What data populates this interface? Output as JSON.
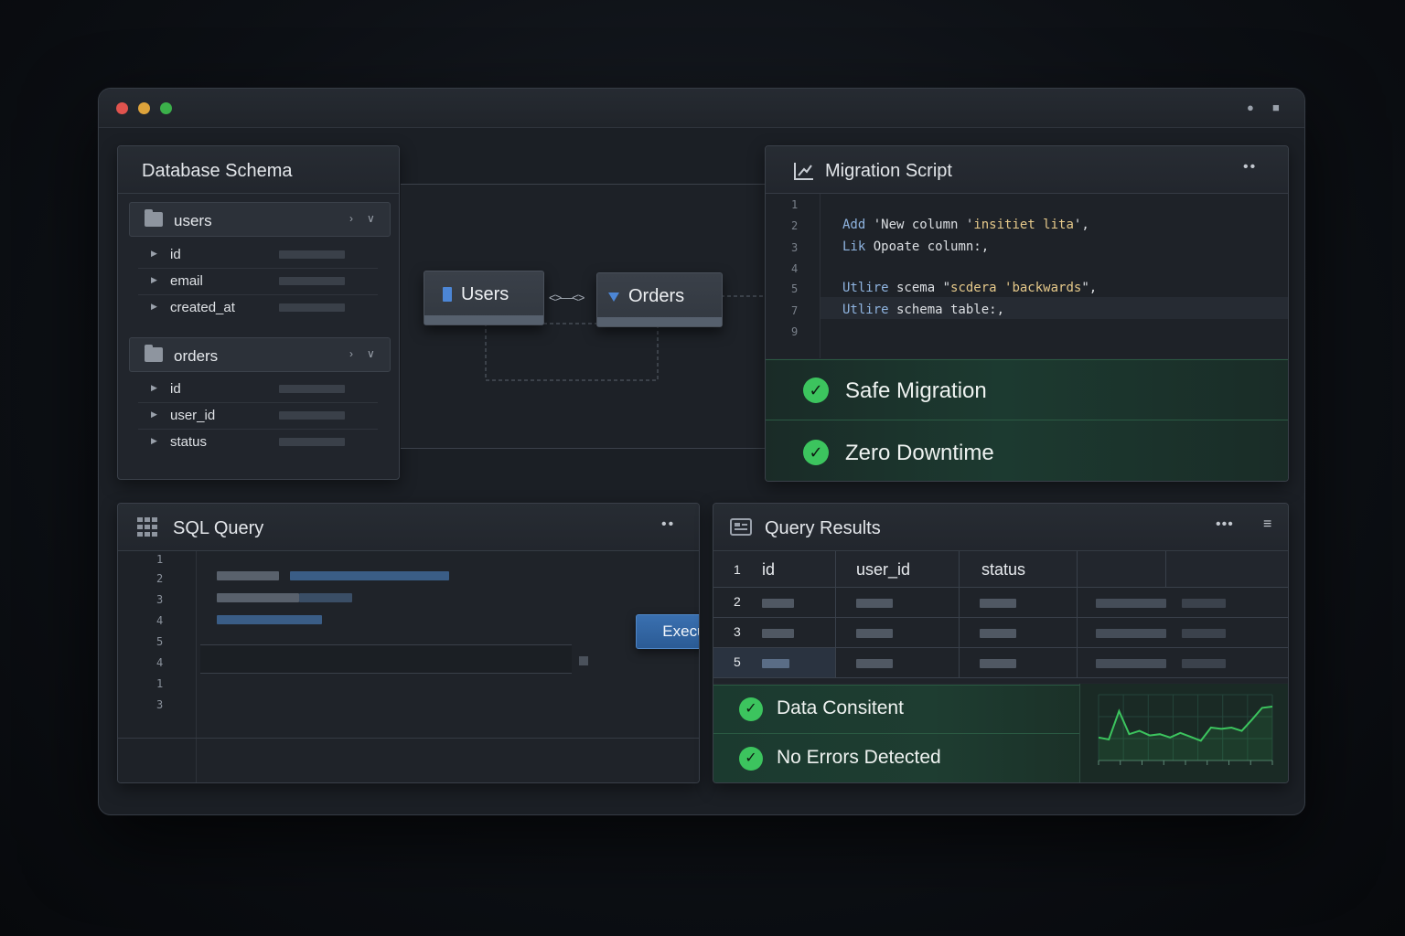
{
  "schema": {
    "title": "Database Schema",
    "tables": [
      {
        "name": "users",
        "columns": [
          "id",
          "email",
          "created_at"
        ]
      },
      {
        "name": "orders",
        "columns": [
          "id",
          "user_id",
          "status"
        ]
      }
    ]
  },
  "diagram": {
    "nodes": [
      "Users",
      "Orders"
    ],
    "connector": "<>"
  },
  "migration": {
    "title": "Migration Script",
    "line_numbers": [
      "1",
      "2",
      "3",
      "4",
      "5",
      "7",
      "9"
    ],
    "lines": [
      {
        "kw": "",
        "text": ""
      },
      {
        "kw": "Add",
        "text": " 'New column '",
        "str": "insitiet lita",
        "tail": "',"
      },
      {
        "kw": "Lik",
        "text": " Opoate column:,"
      },
      {
        "kw": "",
        "text": ""
      },
      {
        "kw": "Utlire",
        "text": " scema \"",
        "str": "scdera 'backwards",
        "tail": "\","
      },
      {
        "kw": "Utlire",
        "text": " schema table:,"
      },
      {
        "kw": "",
        "text": ""
      }
    ],
    "checks": [
      "Safe Migration",
      "Zero Downtime"
    ]
  },
  "sql": {
    "title": "SQL Query",
    "line_numbers": [
      "1",
      "2",
      "3",
      "4",
      "5",
      "4",
      "1",
      "3"
    ],
    "execute_label": "Execute"
  },
  "results": {
    "title": "Query Results",
    "columns": [
      "id",
      "user_id",
      "status"
    ],
    "row_numbers": [
      "1",
      "2",
      "3",
      "5"
    ],
    "status": [
      "Data Consitent",
      "No Errors Detected"
    ],
    "sparkline": [
      0.35,
      0.32,
      0.75,
      0.4,
      0.45,
      0.38,
      0.4,
      0.35,
      0.42,
      0.36,
      0.3,
      0.5,
      0.48,
      0.5,
      0.45,
      0.62,
      0.8,
      0.82
    ]
  },
  "colors": {
    "accent_green": "#3cc45e",
    "execute_blue": "#2f64a4"
  },
  "icons": [
    "folder-icon",
    "migration-icon",
    "grid-icon",
    "results-icon",
    "check-icon"
  ]
}
